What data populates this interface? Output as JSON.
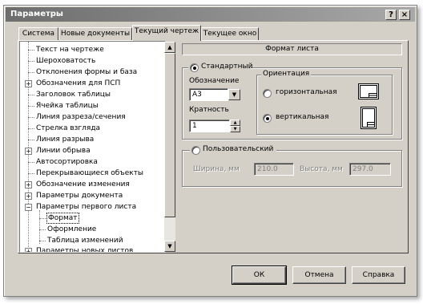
{
  "window": {
    "title": "Параметры",
    "help_btn": "?",
    "close_btn": "×"
  },
  "tabs": [
    {
      "label": "Система"
    },
    {
      "label": "Новые документы"
    },
    {
      "label": "Текущий чертеж"
    },
    {
      "label": "Текущее окно"
    }
  ],
  "tree": {
    "items": [
      {
        "label": "Текст на чертеже",
        "expander": ""
      },
      {
        "label": "Шероховатость",
        "expander": ""
      },
      {
        "label": "Отклонения формы и база",
        "expander": ""
      },
      {
        "label": "Обозначения для ПСП",
        "expander": "+"
      },
      {
        "label": "Заголовок таблицы",
        "expander": ""
      },
      {
        "label": "Ячейка таблицы",
        "expander": ""
      },
      {
        "label": "Линия разреза/сечения",
        "expander": ""
      },
      {
        "label": "Стрелка взгляда",
        "expander": ""
      },
      {
        "label": "Линия разрыва",
        "expander": ""
      },
      {
        "label": "Линии обрыва",
        "expander": "+"
      },
      {
        "label": "Автосортировка",
        "expander": ""
      },
      {
        "label": "Перекрывающиеся объекты",
        "expander": ""
      },
      {
        "label": "Обозначение изменения",
        "expander": "+"
      },
      {
        "label": "Параметры документа",
        "expander": "+"
      },
      {
        "label": "Параметры первого листа",
        "expander": "−"
      },
      {
        "label": "Формат",
        "expander": ""
      },
      {
        "label": "Оформление",
        "expander": ""
      },
      {
        "label": "Таблица изменений",
        "expander": ""
      },
      {
        "label": "Параметры новых листов",
        "expander": "+"
      }
    ],
    "scroll_up": "▲",
    "scroll_down": "▼"
  },
  "panel": {
    "header": "Формат листа",
    "standard": {
      "label": "Стандартный",
      "designation_label": "Обозначение",
      "designation_value": "А3",
      "dropdown_arrow": "▼",
      "multiplicity_label": "Кратность",
      "multiplicity_value": "1",
      "spin_up": "▲",
      "spin_down": "▼"
    },
    "orientation": {
      "label": "Ориентация",
      "horizontal": "горизонтальная",
      "vertical": "вертикальная",
      "selected": "vertical"
    },
    "custom": {
      "label": "Пользовательский",
      "width_label": "Ширина, мм",
      "width_value": "210.0",
      "height_label": "Высота, мм",
      "height_value": "297.0"
    }
  },
  "buttons": {
    "ok": "ОК",
    "cancel": "Отмена",
    "help": "Справка"
  }
}
